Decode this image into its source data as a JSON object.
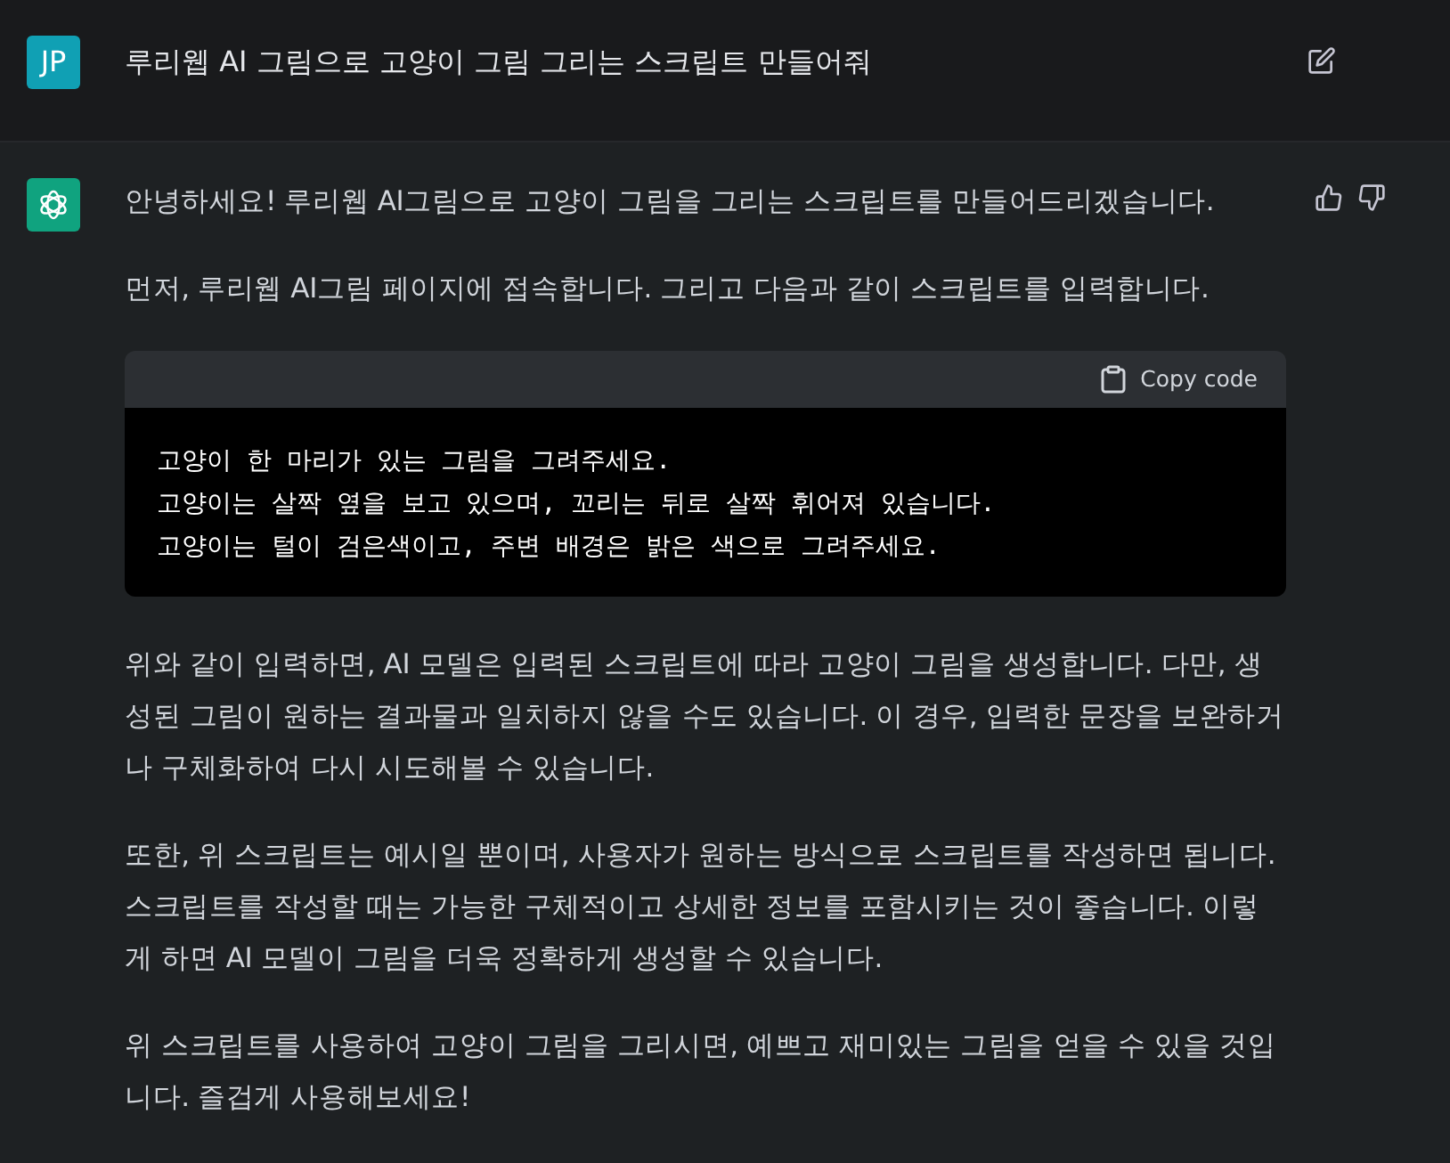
{
  "user_message": {
    "avatar": "JP",
    "text": "루리웹 AI 그림으로 고양이 그림 그리는 스크립트 만들어줘"
  },
  "assistant_message": {
    "blocks": [
      {
        "kind": "paragraph",
        "text": "안녕하세요! 루리웹 AI그림으로 고양이 그림을 그리는 스크립트를 만들어드리겠습니다."
      },
      {
        "kind": "paragraph",
        "text": "먼저, 루리웹 AI그림 페이지에 접속합니다. 그리고 다음과 같이 스크립트를 입력합니다."
      },
      {
        "kind": "code",
        "copy_label": "Copy code",
        "lines": [
          "고양이 한 마리가 있는 그림을 그려주세요.",
          "고양이는 살짝 옆을 보고 있으며, 꼬리는 뒤로 살짝 휘어져 있습니다.",
          "고양이는 털이 검은색이고, 주변 배경은 밝은 색으로 그려주세요."
        ]
      },
      {
        "kind": "paragraph",
        "text": "위와 같이 입력하면, AI 모델은 입력된 스크립트에 따라 고양이 그림을 생성합니다. 다만, 생성된 그림이 원하는 결과물과 일치하지 않을 수도 있습니다. 이 경우, 입력한 문장을 보완하거나 구체화하여 다시 시도해볼 수 있습니다."
      },
      {
        "kind": "paragraph",
        "text": "또한, 위 스크립트는 예시일 뿐이며, 사용자가 원하는 방식으로 스크립트를 작성하면 됩니다. 스크립트를 작성할 때는 가능한 구체적이고 상세한 정보를 포함시키는 것이 좋습니다. 이렇게 하면 AI 모델이 그림을 더욱 정확하게 생성할 수 있습니다."
      },
      {
        "kind": "paragraph",
        "text": "위 스크립트를 사용하여 고양이 그림을 그리시면, 예쁘고 재미있는 그림을 얻을 수 있을 것입니다. 즐겁게 사용해보세요!"
      }
    ]
  }
}
